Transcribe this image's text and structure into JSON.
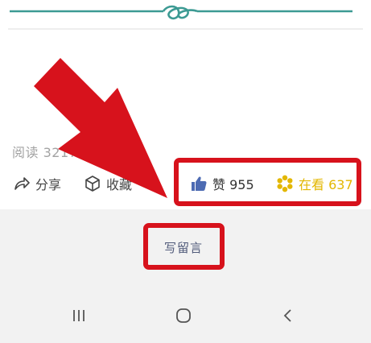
{
  "article": {
    "read_count_label": "阅读 3217"
  },
  "actions": {
    "share_label": "分享",
    "favorite_label": "收藏",
    "like_label": "赞 955",
    "watch_label": "在看 637"
  },
  "comment": {
    "write_label": "写留言"
  },
  "colors": {
    "ornament": "#3c9a93",
    "annotation_red": "#d7121c",
    "like_blue": "#4d6bb3",
    "watch_yellow": "#e3b700",
    "write_text": "#505a7a"
  },
  "icons": {
    "share": "share-icon",
    "favorite": "cube-icon",
    "like": "thumbs-up-icon",
    "watch": "flower-icon",
    "recent": "recent-apps-icon",
    "home": "home-icon",
    "back": "back-icon"
  }
}
